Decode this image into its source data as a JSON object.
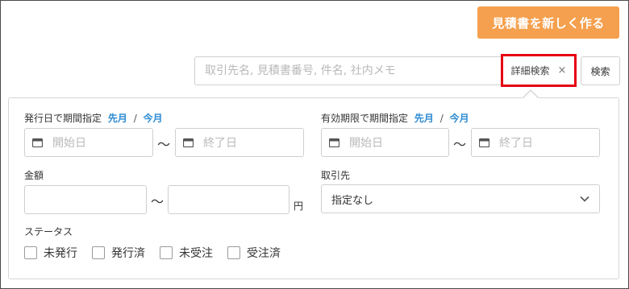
{
  "header": {
    "create_button_label": "見積書を新しく作る"
  },
  "search": {
    "placeholder": "取引先名, 見積書番号, 件名, 社内メモ",
    "detail_toggle_label": "詳細検索",
    "detail_close_glyph": "×",
    "search_button_label": "検索"
  },
  "filters": {
    "issue_date": {
      "label": "発行日で期間指定",
      "this_month_prev": "先月",
      "separator": "/",
      "this_month": "今月",
      "start_placeholder": "開始日",
      "end_placeholder": "終了日",
      "tilde": "～"
    },
    "expiry_date": {
      "label": "有効期限で期間指定",
      "this_month_prev": "先月",
      "separator": "/",
      "this_month": "今月",
      "start_placeholder": "開始日",
      "end_placeholder": "終了日",
      "tilde": "～"
    },
    "amount": {
      "label": "金額",
      "tilde": "～",
      "unit": "円"
    },
    "client": {
      "label": "取引先",
      "selected": "指定なし"
    },
    "status": {
      "label": "ステータス",
      "options": [
        "未発行",
        "発行済",
        "未受注",
        "受注済"
      ]
    }
  },
  "colors": {
    "accent": "#f5a04e",
    "link": "#2d8bd3",
    "highlight": "#e60012"
  },
  "icons": {
    "calendar": "calendar-icon",
    "chevron": "chevron-down-icon",
    "close": "close-icon"
  }
}
